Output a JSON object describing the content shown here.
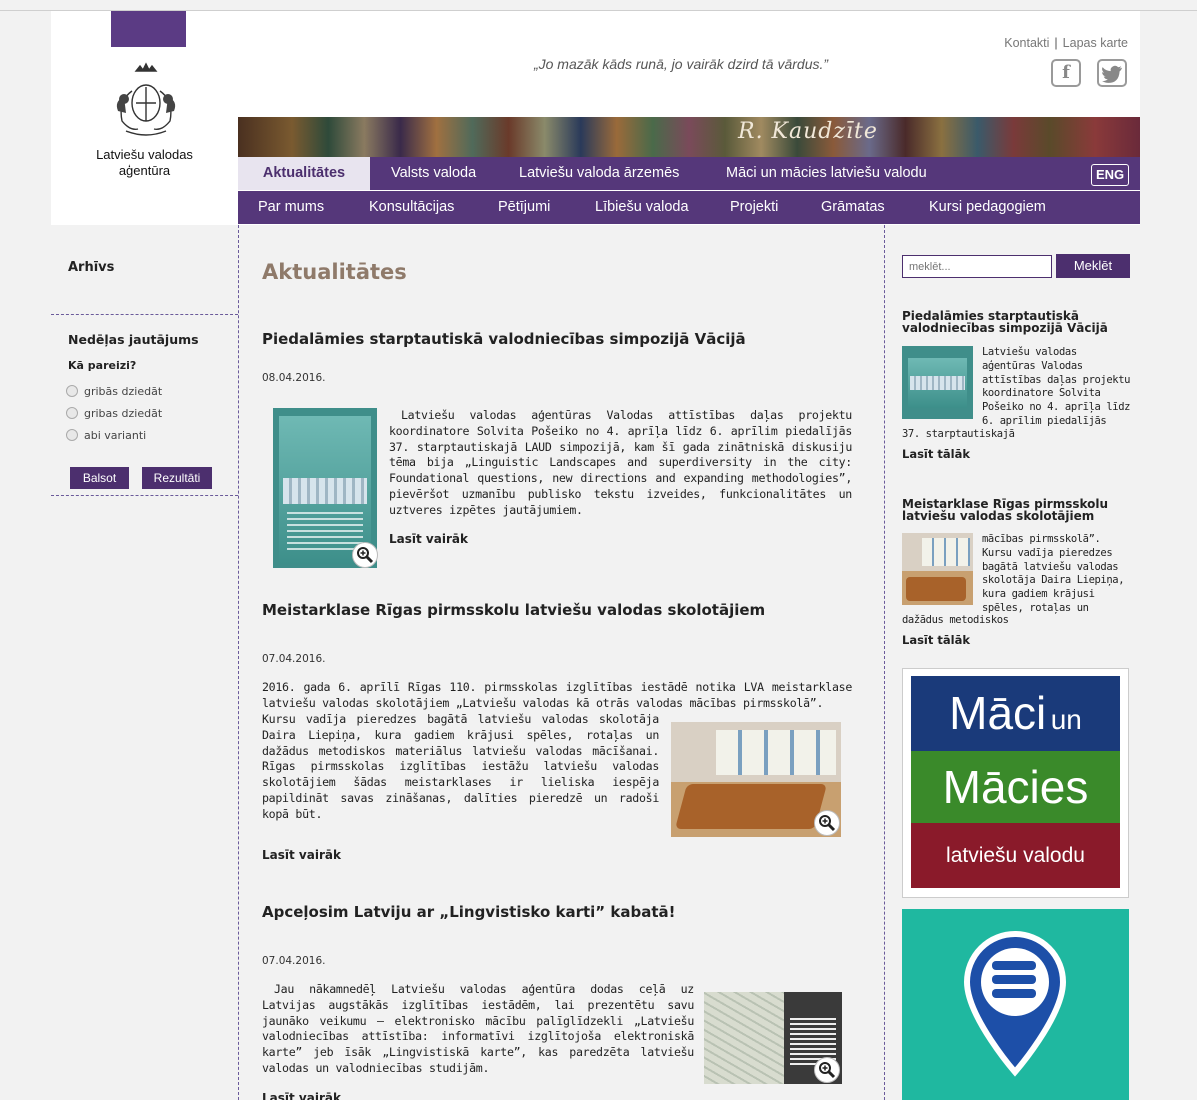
{
  "header": {
    "org_name_line1": "Latviešu valodas",
    "org_name_line2": "aģentūra",
    "quote": "„Jo mazāk kāds runā, jo vairāk dzird tā vārdus.”",
    "links": {
      "contacts": "Kontakti",
      "sitemap": "Lapas karte",
      "separator": "|"
    },
    "signature": "R. Kaudzīte",
    "social": [
      "facebook-icon",
      "twitter-icon"
    ]
  },
  "nav": {
    "row1": [
      "Aktualitātes",
      "Valsts valoda",
      "Latviešu valoda ārzemēs",
      "Māci un mācies latviešu valodu"
    ],
    "row2": [
      "Par mums",
      "Konsultācijas",
      "Pētījumi",
      "Lībiešu valoda",
      "Projekti",
      "Grāmatas",
      "Kursi pedagogiem"
    ],
    "lang": "ENG",
    "active": "Aktualitātes"
  },
  "left": {
    "archive": "Arhīvs",
    "poll_title": "Nedēļas jautājums",
    "poll_question": "Kā pareizi?",
    "options": [
      "gribās dziedāt",
      "gribas dziedāt",
      "abi varianti"
    ],
    "vote_button": "Balsot",
    "results_button": "Rezultāti"
  },
  "main": {
    "heading": "Aktualitātes",
    "articles": [
      {
        "title": "Piedalāmies starptautiskā valodniecības simpozijā Vācijā",
        "date": "08.04.2016.",
        "text": "Latviešu valodas aģentūras Valodas attīstības daļas projektu koordinatore Solvita Pošeiko no 4. aprīļa līdz 6. aprīlim piedalījās 37. starptautiskajā LAUD simpozijā, kam šī gada zinātniskā diskusiju tēma bija „Linguistic Landscapes and superdiversity in the city: Foundational questions, new directions and expanding methodologies”, pievēršot uzmanību publisko tekstu izveides, funkcionalitātes un uztveres izpētes jautājumiem.",
        "read_more": "Lasīt vairāk"
      },
      {
        "title": "Meistarklase Rīgas pirmsskolu latviešu valodas skolotājiem",
        "date": "07.04.2016.",
        "text_top": "2016. gada 6. aprīlī Rīgas 110. pirmsskolas izglītības iestādē notika LVA meistarklase latviešu valodas skolotājiem „Latviešu valodas kā otrās valodas mācības pirmsskolā”.",
        "text_side": "Kursu vadīja pieredzes bagātā latviešu valodas skolotāja Daira Liepiņa, kura gadiem krājusi spēles, rotaļas un dažādus metodiskos materiālus latviešu valodas mācīšanai. Rīgas pirmsskolas izglītības iestāžu latviešu valodas skolotājiem šādas meistarklases ir lieliska iespēja papildināt savas zināšanas, dalīties pieredzē un radoši kopā būt.",
        "read_more": "Lasīt vairāk"
      },
      {
        "title": "Apceļosim Latviju ar „Lingvistisko karti” kabatā!",
        "date": "07.04.2016.",
        "text": "Jau nākamnedēļ Latviešu valodas aģentūra dodas ceļā uz Latvijas augstākās izglītības iestādēm, lai prezentētu savu jaunāko veikumu – elektronisko mācību palīglīdzekli „Latviešu valodniecības attīstība: informatīvi izglītojoša elektroniskā karte” jeb īsāk „Lingvistiskā karte”, kas paredzēta latviešu valodas un valodniecības studijām.",
        "read_more": "Lasīt vairāk"
      }
    ]
  },
  "right": {
    "search_placeholder": "meklēt...",
    "search_button": "Meklēt",
    "items": [
      {
        "title": "Piedalāmies starptautiskā valodniecības simpozijā Vācijā",
        "text_side": "Latviešu valodas aģentūras Valodas attīstības daļas projektu koordinatore Solvita Pošeiko no 4. aprīļa līdz 6. aprīlim piedalījās",
        "text_below": "37. starptautiskajā",
        "more": "Lasīt tālāk"
      },
      {
        "title": "Meistarklase Rīgas pirmsskolu latviešu valodas skolotājiem",
        "text_side": "mācības pirmsskolā”. Kursu vadīja pieredzes bagātā latviešu valodas skolotāja Daira Liepiņa, kura gadiem krājusi spēles, rotaļas un",
        "text_below": "dažādus metodiskos",
        "more": "Lasīt tālāk"
      }
    ],
    "banner": {
      "line1": "Māci",
      "line1b": "un",
      "line2": "Mācies",
      "line3": "latviešu valodu"
    },
    "colors": {
      "blue": "#1a3a7a",
      "green": "#3a8a2a",
      "red": "#8a1a2a",
      "teal": "#1fb8a0"
    }
  }
}
